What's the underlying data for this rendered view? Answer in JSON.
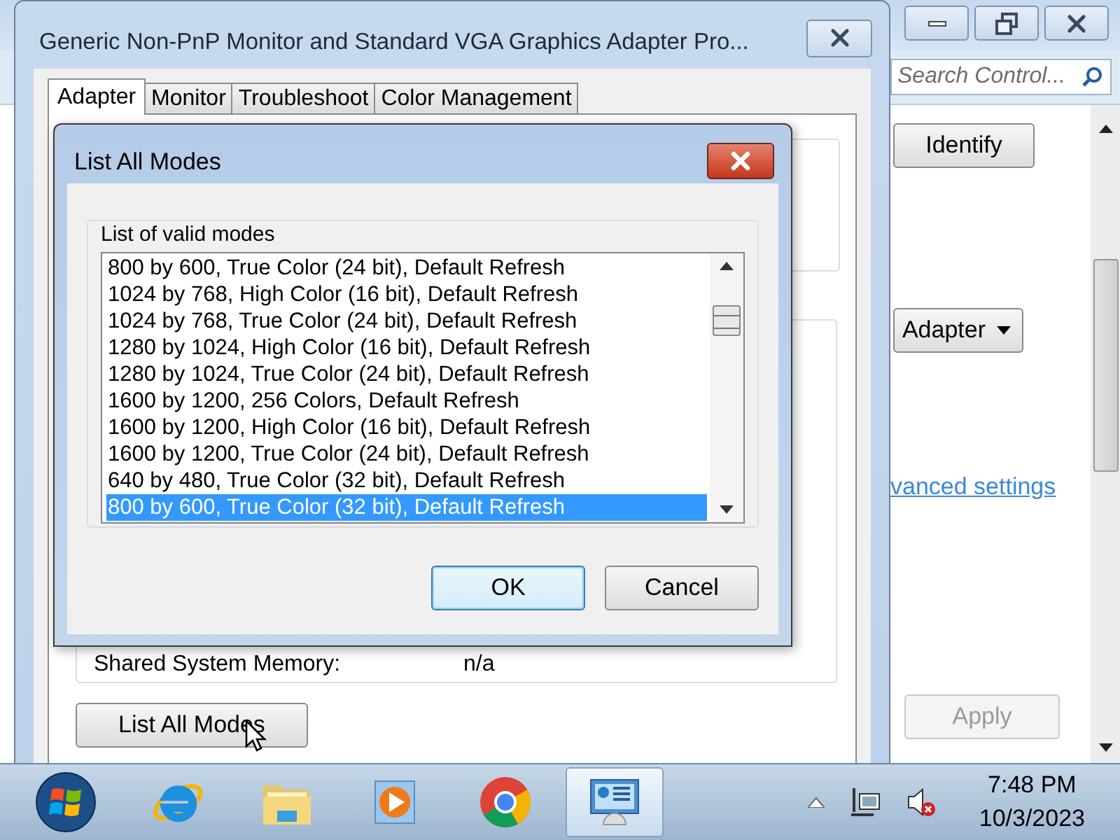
{
  "background_window": {
    "search": {
      "placeholder": "Search Control..."
    },
    "identify_button": "Identify",
    "adapter_dropdown": "Adapter",
    "link": "vanced settings",
    "apply_button": {
      "label": "Apply",
      "disabled": true
    }
  },
  "properties_window": {
    "title": "Generic Non-PnP Monitor and Standard VGA Graphics Adapter Pro...",
    "tabs": [
      {
        "label": "Adapter",
        "selected": true
      },
      {
        "label": "Monitor",
        "selected": false
      },
      {
        "label": "Troubleshoot",
        "selected": false
      },
      {
        "label": "Color Management",
        "selected": false
      }
    ],
    "shared_memory": {
      "label": "Shared System Memory:",
      "value": "n/a"
    },
    "list_all_modes_button": "List All Modes"
  },
  "dialog": {
    "title": "List All Modes",
    "group_label": "List of valid modes",
    "modes": [
      {
        "label": "800 by 600, True Color (24 bit), Default Refresh",
        "selected": false
      },
      {
        "label": "1024 by 768, High Color (16 bit), Default Refresh",
        "selected": false
      },
      {
        "label": "1024 by 768, True Color (24 bit), Default Refresh",
        "selected": false
      },
      {
        "label": "1280 by 1024, High Color (16 bit), Default Refresh",
        "selected": false
      },
      {
        "label": "1280 by 1024, True Color (24 bit), Default Refresh",
        "selected": false
      },
      {
        "label": "1600 by 1200, 256 Colors, Default Refresh",
        "selected": false
      },
      {
        "label": "1600 by 1200, High Color (16 bit), Default Refresh",
        "selected": false
      },
      {
        "label": "1600 by 1200, True Color (24 bit), Default Refresh",
        "selected": false
      },
      {
        "label": "640 by 480, True Color (32 bit), Default Refresh",
        "selected": false
      },
      {
        "label": "800 by 600, True Color (32 bit), Default Refresh",
        "selected": true
      }
    ],
    "ok_button": {
      "label": "OK",
      "default": true
    },
    "cancel_button": {
      "label": "Cancel",
      "default": false
    }
  },
  "taskbar": {
    "apps": [
      {
        "kind": "ie",
        "active": false
      },
      {
        "kind": "folder",
        "active": false
      },
      {
        "kind": "media",
        "active": false
      },
      {
        "kind": "chrome",
        "active": false
      },
      {
        "kind": "control-panel",
        "active": true
      }
    ],
    "clock": {
      "time": "7:48 PM",
      "date": "10/3/2023"
    }
  }
}
